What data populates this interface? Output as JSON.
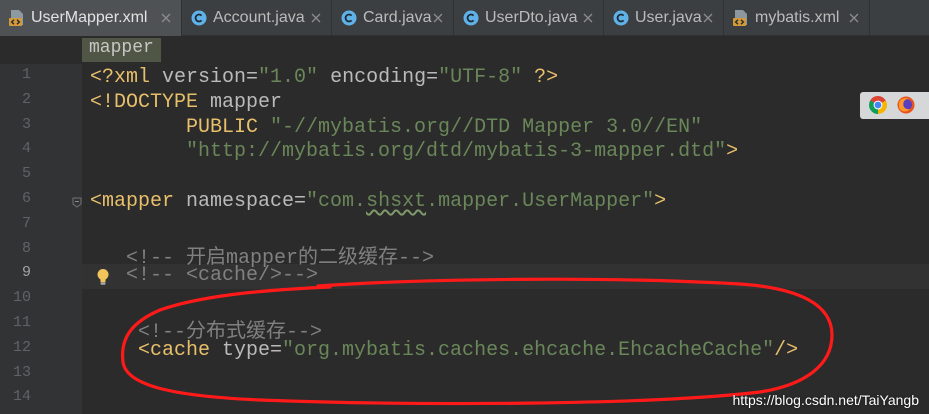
{
  "tabs": [
    {
      "label": "UserMapper.xml",
      "icon": "xml-file-icon",
      "active": true
    },
    {
      "label": "Account.java",
      "icon": "java-class-icon",
      "active": false
    },
    {
      "label": "Card.java",
      "icon": "java-class-icon",
      "active": false
    },
    {
      "label": "UserDto.java",
      "icon": "java-class-icon",
      "active": false
    },
    {
      "label": "User.java",
      "icon": "java-class-icon",
      "active": false
    },
    {
      "label": "mybatis.xml",
      "icon": "xml-file-icon",
      "active": false
    }
  ],
  "breadcrumb": {
    "items": [
      "mapper"
    ]
  },
  "editor": {
    "current_line": 9,
    "lines": [
      {
        "number": "1",
        "tokens": [
          "<?xml",
          " version=",
          "\"1.0\"",
          " encoding=",
          "\"UTF-8\"",
          " ?>"
        ]
      },
      {
        "number": "2",
        "tokens": [
          "<!DOCTYPE",
          " mapper"
        ]
      },
      {
        "number": "3",
        "tokens": [
          "PUBLIC",
          " \"-//mybatis.org//DTD Mapper 3.0//EN\""
        ]
      },
      {
        "number": "4",
        "tokens": [
          "\"http://mybatis.org/dtd/mybatis-3-mapper.dtd\"",
          ">"
        ]
      },
      {
        "number": "5",
        "tokens": []
      },
      {
        "number": "6",
        "tokens": [
          "<mapper",
          " namespace=",
          "\"com.",
          "shsxt",
          ".mapper.UserMapper\"",
          ">"
        ]
      },
      {
        "number": "7",
        "tokens": []
      },
      {
        "number": "8",
        "tokens": [
          "<!-- 开启mapper的二级缓存-->"
        ]
      },
      {
        "number": "9",
        "tokens": [
          "<!-- <cache/>-->"
        ]
      },
      {
        "number": "10",
        "tokens": []
      },
      {
        "number": "11",
        "tokens": [
          "<!--分布式缓存-->"
        ]
      },
      {
        "number": "12",
        "tokens": [
          "<cache",
          " type=",
          "\"org.mybatis.caches.ehcache.EhcacheCache\"",
          "/>"
        ]
      },
      {
        "number": "13",
        "tokens": []
      },
      {
        "number": "14",
        "tokens": []
      }
    ]
  },
  "browser_toolbar": {
    "icons": [
      "chrome-icon",
      "firefox-icon"
    ]
  },
  "watermark": "https://blog.csdn.net/TaiYangb",
  "colors": {
    "tab_bar": "#3c3f41",
    "editor_bg": "#2b2b2b",
    "gutter_bg": "#313335",
    "tag": "#e8bf6a",
    "attribute": "#bababa",
    "string": "#6a8759",
    "comment": "#808080",
    "annotation_stroke": "#ff1a1a"
  }
}
